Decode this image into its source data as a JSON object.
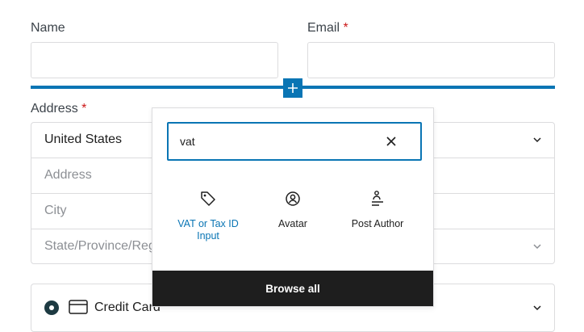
{
  "form": {
    "name_label": "Name",
    "email_label": "Email",
    "required_mark": "*",
    "address_label": "Address",
    "address": {
      "country_value": "United States",
      "address_placeholder": "Address",
      "city_placeholder": "City",
      "state_placeholder": "State/Province/Region"
    },
    "payment": {
      "credit_card_label": "Credit Card"
    }
  },
  "inserter": {
    "search_value": "vat",
    "results": [
      {
        "label": "VAT or Tax ID Input",
        "icon": "tag-icon"
      },
      {
        "label": "Avatar",
        "icon": "user-circle-icon"
      },
      {
        "label": "Post Author",
        "icon": "post-author-icon"
      }
    ],
    "browse_all_label": "Browse all"
  },
  "colors": {
    "accent": "#0a75b4",
    "required": "#cc1818",
    "dark": "#1e1e1e"
  }
}
